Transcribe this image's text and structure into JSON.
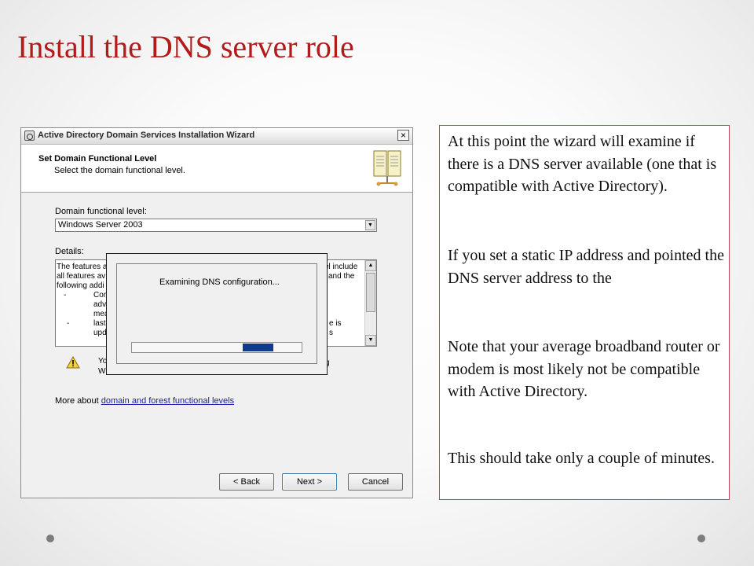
{
  "slide": {
    "title": "Install the DNS server role"
  },
  "wizard": {
    "window_title": "Active Directory Domain Services Installation Wizard",
    "close_label": "×",
    "header_title": "Set Domain Functional Level",
    "header_subtitle": "Select the domain functional level.",
    "level_label": "Domain functional level:",
    "level_value": "Windows Server 2003",
    "details_label": "Details:",
    "details_visible": {
      "left_lines": [
        "The features a",
        "all features av",
        "following addi"
      ],
      "dash1": "-",
      "item1_lines": [
        "Cor",
        "adv",
        "mea"
      ],
      "dash2": "-",
      "item2_lines": [
        "last",
        "upd"
      ],
      "right_lines": [
        "el include",
        "and the",
        "e is",
        "s"
      ]
    },
    "warning_visible": {
      "left": [
        "Yo",
        "W"
      ],
      "right": "g"
    },
    "more_about_prefix": "More about ",
    "more_about_link": "domain and forest functional levels",
    "buttons": {
      "back": "< Back",
      "next": "Next >",
      "cancel": "Cancel"
    },
    "progress": {
      "message": "Examining DNS configuration...",
      "fill_fraction": 0.18
    }
  },
  "note": {
    "paragraphs": [
      "At this point the wizard will examine if there is a DNS server available (one that is compatible with Active Directory).",
      "If you set a static IP address and pointed the DNS server address to the",
      "Note that your average broadband router or modem is most likely not be compatible with Active Directory.",
      "This should take only a couple of minutes."
    ]
  },
  "icons": {
    "warning": "warning-triangle-icon",
    "book": "book-icon",
    "app": "wizard-app-icon"
  },
  "colors": {
    "title": "#b31b1b",
    "note_border": "#c0424f",
    "progress": "#0f3a8f",
    "link": "#1a1aa8"
  }
}
